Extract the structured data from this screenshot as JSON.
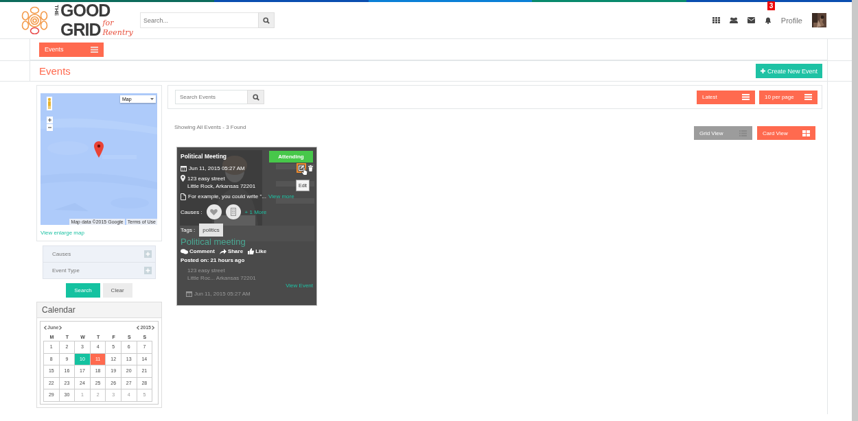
{
  "header": {
    "logo": {
      "small_word": "THE",
      "line1": "GOOD",
      "line2": "GRID",
      "tagline": "for Reentry"
    },
    "search": {
      "placeholder": "Search..."
    },
    "notification_count": "3",
    "profile_label": "Profile"
  },
  "subnav": {
    "menu_button": "Events"
  },
  "page_title": "Events",
  "create_button": "Create New Event",
  "map": {
    "type_selector": "Map",
    "attribution": "Map data ©2015 Google",
    "terms": "Terms of Use",
    "enlarge_link": "View enlarge map"
  },
  "filters": [
    {
      "label": "Causes",
      "expanded": false
    },
    {
      "label": "Event Type",
      "expanded": false
    }
  ],
  "filter_buttons": [
    {
      "label": "Search",
      "kind": "primary"
    },
    {
      "label": "Clear",
      "kind": "secondary"
    }
  ],
  "calendar": {
    "title": "Calendar",
    "month": "June",
    "year": "2015",
    "weekdays": [
      "M",
      "T",
      "W",
      "T",
      "F",
      "S",
      "S"
    ],
    "days": [
      {
        "label": "1",
        "selected": false,
        "today": false,
        "outside": false
      },
      {
        "label": "2",
        "selected": false,
        "today": false,
        "outside": false
      },
      {
        "label": "3",
        "selected": false,
        "today": false,
        "outside": false
      },
      {
        "label": "4",
        "selected": false,
        "today": false,
        "outside": false
      },
      {
        "label": "5",
        "selected": false,
        "today": false,
        "outside": false
      },
      {
        "label": "6",
        "selected": false,
        "today": false,
        "outside": false
      },
      {
        "label": "7",
        "selected": false,
        "today": false,
        "outside": false
      },
      {
        "label": "8",
        "selected": false,
        "today": false,
        "outside": false
      },
      {
        "label": "9",
        "selected": false,
        "today": false,
        "outside": false
      },
      {
        "label": "10",
        "selected": true,
        "today": false,
        "outside": false
      },
      {
        "label": "11",
        "selected": false,
        "today": true,
        "outside": false
      },
      {
        "label": "12",
        "selected": false,
        "today": false,
        "outside": false
      },
      {
        "label": "13",
        "selected": false,
        "today": false,
        "outside": false
      },
      {
        "label": "14",
        "selected": false,
        "today": false,
        "outside": false
      },
      {
        "label": "15",
        "selected": false,
        "today": false,
        "outside": false
      },
      {
        "label": "16",
        "selected": false,
        "today": false,
        "outside": false
      },
      {
        "label": "17",
        "selected": false,
        "today": false,
        "outside": false
      },
      {
        "label": "18",
        "selected": false,
        "today": false,
        "outside": false
      },
      {
        "label": "19",
        "selected": false,
        "today": false,
        "outside": false
      },
      {
        "label": "20",
        "selected": false,
        "today": false,
        "outside": false
      },
      {
        "label": "21",
        "selected": false,
        "today": false,
        "outside": false
      },
      {
        "label": "22",
        "selected": false,
        "today": false,
        "outside": false
      },
      {
        "label": "23",
        "selected": false,
        "today": false,
        "outside": false
      },
      {
        "label": "24",
        "selected": false,
        "today": false,
        "outside": false
      },
      {
        "label": "25",
        "selected": false,
        "today": false,
        "outside": false
      },
      {
        "label": "26",
        "selected": false,
        "today": false,
        "outside": false
      },
      {
        "label": "27",
        "selected": false,
        "today": false,
        "outside": false
      },
      {
        "label": "28",
        "selected": false,
        "today": false,
        "outside": false
      },
      {
        "label": "29",
        "selected": false,
        "today": false,
        "outside": false
      },
      {
        "label": "30",
        "selected": false,
        "today": false,
        "outside": false
      },
      {
        "label": "1",
        "selected": false,
        "today": false,
        "outside": true
      },
      {
        "label": "2",
        "selected": false,
        "today": false,
        "outside": true
      },
      {
        "label": "3",
        "selected": false,
        "today": false,
        "outside": true
      },
      {
        "label": "4",
        "selected": false,
        "today": false,
        "outside": true
      },
      {
        "label": "5",
        "selected": false,
        "today": false,
        "outside": true
      }
    ]
  },
  "events_toolbar": {
    "search": {
      "placeholder": "Search Events"
    },
    "sort": "Latest",
    "per_page": "10 per page"
  },
  "result_summary": "Showing All Events - 3 Found",
  "views": [
    {
      "label": "Grid View",
      "kind": "grid",
      "selected": false
    },
    {
      "label": "Card View",
      "kind": "card",
      "selected": true
    }
  ],
  "event_card": {
    "title": "Political Meeting",
    "status": "Attending",
    "date": "Jun 11, 2015 05:27 AM",
    "address_line1": "123 easy street",
    "address_line2": "Little Rock, Arkansas 72201",
    "description": "For example, you could write \"...",
    "view_more": "View more",
    "causes_label": "Causes :",
    "more_causes": "+ 1 More",
    "tags_label": "Tags :",
    "tags": [
      "politics"
    ],
    "tooltip": "Edit",
    "background_title": "Political meeting",
    "actions": [
      "Comment",
      "Share",
      "Like"
    ],
    "posted": "Posted on: 21 hours ago",
    "background_address1": "123 easy street",
    "background_address2": "Little Roc... Arkansas 72201",
    "view_event": "View Event",
    "background_date": "Jun 11, 2015 05:27 AM"
  }
}
